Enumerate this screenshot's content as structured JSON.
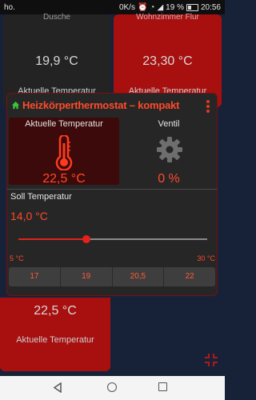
{
  "statusbar": {
    "left_text": "ho.",
    "network_speed": "0K/s",
    "battery_percent": "19 %",
    "time": "20:56"
  },
  "tiles": {
    "top_left": {
      "name": "Dusche",
      "value": "19,9 °C",
      "label": "Aktuelle Temperatur"
    },
    "top_right": {
      "name": "Wohnzimmer Flur",
      "value": "23,30 °C",
      "label": "Aktuelle Temperatur"
    },
    "bottom_left": {
      "value": "22,5 °C",
      "label": "Aktuelle Temperatur"
    }
  },
  "card": {
    "title": "Heizkörperthermostat – kompakt",
    "current_temp_label": "Aktuelle Temperatur",
    "current_temp_value": "22,5 °C",
    "valve_label": "Ventil",
    "valve_value": "0 %",
    "setpoint_label": "Soll Temperatur",
    "setpoint_value": "14,0 °C",
    "slider": {
      "min_label": "5 °C",
      "max_label": "30 °C",
      "min": 5,
      "max": 30,
      "value": 14
    },
    "presets": [
      "17",
      "19",
      "20,5",
      "22"
    ]
  },
  "colors": {
    "accent": "#ff4a2a",
    "tile_red": "#a80f0f",
    "tile_dark": "#232323",
    "background": "#172238"
  },
  "icons": {
    "home": "home-icon",
    "menu": "more-vert-icon",
    "thermometer": "thermometer-icon",
    "valve": "gear-icon",
    "fullscreen": "fullscreen-exit-icon"
  }
}
